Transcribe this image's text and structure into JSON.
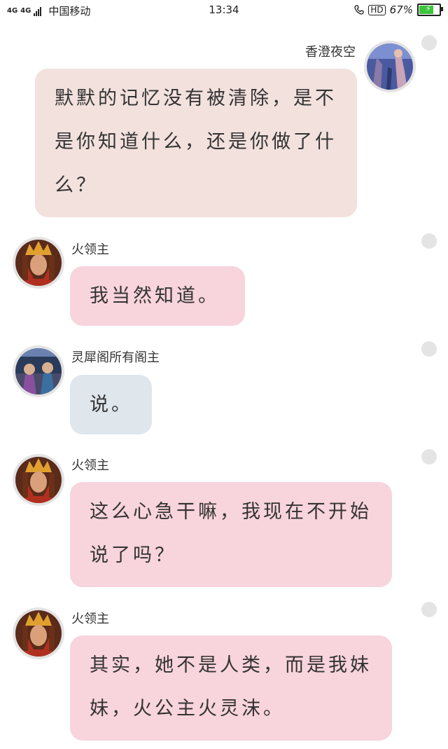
{
  "status_bar": {
    "network_label_1": "4G",
    "network_label_2": "4G",
    "carrier": "中国移动",
    "time": "13:34",
    "hd": "HD",
    "battery_text": "67%",
    "battery_level": 0.67,
    "battery_color": "#3cc43c"
  },
  "colors": {
    "self_bubble": "#f2e1dd",
    "pink_bubble": "#f8d4dc",
    "blue_bubble": "#dfe6ec",
    "avatar_ring": "#e3e3e3"
  },
  "messages": [
    {
      "sender": "香澄夜空",
      "text": "默默的记忆没有被清除，是不是你知道什么，还是你做了什么？"
    },
    {
      "sender": "火领主",
      "text": "我当然知道。"
    },
    {
      "sender": "灵犀阁所有阁主",
      "text": "说。"
    },
    {
      "sender": "火领主",
      "text": "这么心急干嘛，我现在不开始说了吗？"
    },
    {
      "sender": "火领主",
      "text": "其实，她不是人类，而是我妹妹，火公主火灵沫。"
    }
  ]
}
